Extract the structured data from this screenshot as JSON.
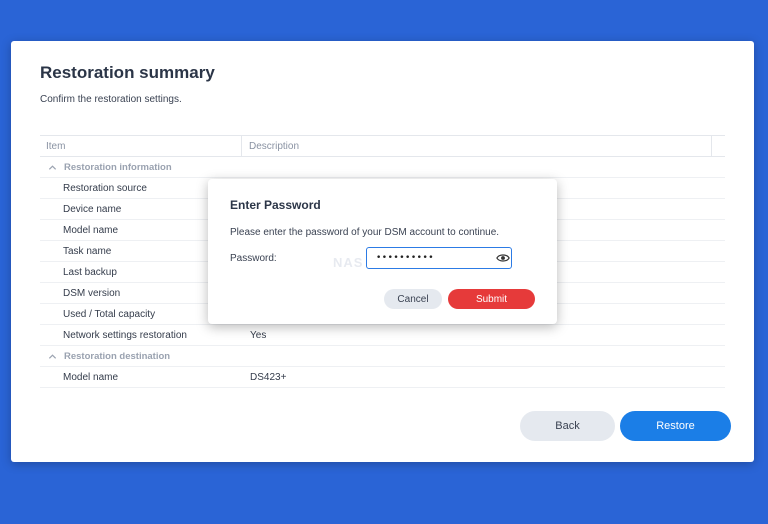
{
  "page": {
    "title": "Restoration summary",
    "subtitle": "Confirm the restoration settings."
  },
  "table": {
    "headers": {
      "item": "Item",
      "description": "Description"
    },
    "groups": [
      {
        "label": "Restoration information",
        "rows": [
          {
            "item": "Restoration source",
            "description": ""
          },
          {
            "item": "Device name",
            "description": ""
          },
          {
            "item": "Model name",
            "description": ""
          },
          {
            "item": "Task name",
            "description": ""
          },
          {
            "item": "Last backup",
            "description": ""
          },
          {
            "item": "DSM version",
            "description": ""
          },
          {
            "item": "Used / Total capacity",
            "description": ""
          },
          {
            "item": "Network settings restoration",
            "description": "Yes"
          }
        ]
      },
      {
        "label": "Restoration destination",
        "rows": [
          {
            "item": "Model name",
            "description": "DS423+"
          }
        ]
      }
    ]
  },
  "footer": {
    "back_label": "Back",
    "restore_label": "Restore"
  },
  "modal": {
    "title": "Enter Password",
    "message": "Please enter the password of your DSM account to continue.",
    "password_label": "Password:",
    "password_value": "••••••••••",
    "watermark": "NAS COMPARES",
    "cancel_label": "Cancel",
    "submit_label": "Submit"
  },
  "icons": {
    "group_toggle": "chevron-up-icon",
    "show_password": "eye-icon"
  },
  "colors": {
    "background": "#2a64d6",
    "primary": "#1b7ee7",
    "danger": "#e63a3a",
    "secondary_button": "#e5e9ef"
  }
}
